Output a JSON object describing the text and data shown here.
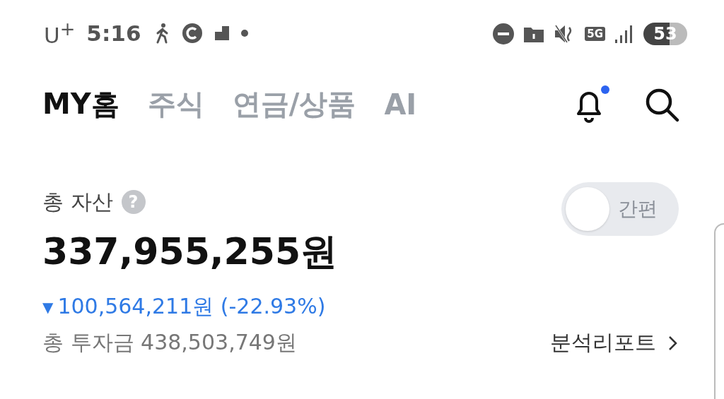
{
  "status_bar": {
    "carrier": "U$^{+}$",
    "time": "5:16",
    "network": "5G",
    "battery": "53"
  },
  "tabs": [
    {
      "label": "MY홈",
      "selected": true
    },
    {
      "label": "주식",
      "selected": false
    },
    {
      "label": "연금/상품",
      "selected": false
    },
    {
      "label": "AI",
      "selected": false
    }
  ],
  "notifications": {
    "unread": true
  },
  "assets": {
    "label": "총 자산",
    "help": "?",
    "toggle": {
      "label": "간편",
      "on": false
    },
    "total": "337,955,255원",
    "change_arrow": "▼",
    "change": "100,564,211원 (-22.93%)",
    "invested": "총 투자금 438,503,749원",
    "report_link": "분석리포트"
  }
}
